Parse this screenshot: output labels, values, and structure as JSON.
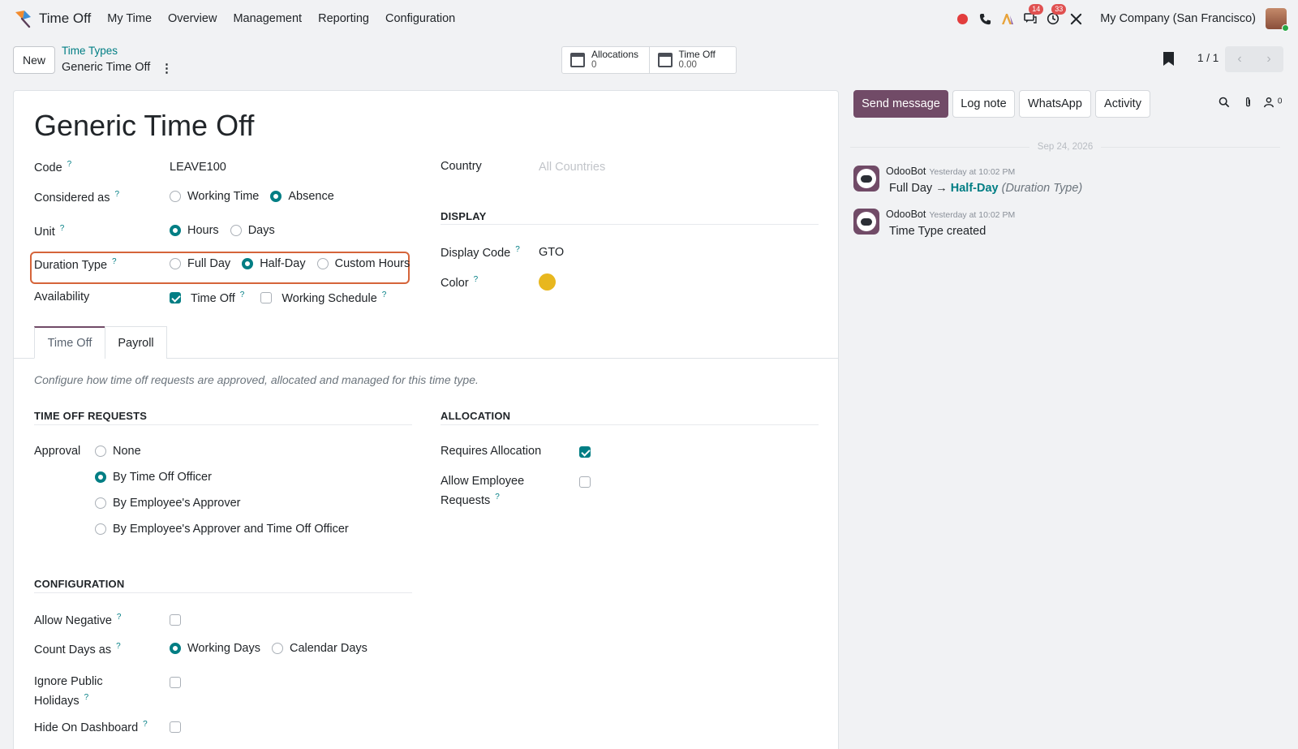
{
  "navbar": {
    "app_name": "Time Off",
    "menu": [
      "My Time",
      "Overview",
      "Management",
      "Reporting",
      "Configuration"
    ],
    "messages_badge": "14",
    "activities_badge": "33",
    "company": "My Company (San Francisco)"
  },
  "control": {
    "new_label": "New",
    "breadcrumb_parent": "Time Types",
    "breadcrumb_current": "Generic Time Off",
    "smart_buttons": [
      {
        "label": "Allocations",
        "value": "0"
      },
      {
        "label": "Time Off",
        "value": "0.00"
      }
    ],
    "pager": "1 / 1"
  },
  "form": {
    "title": "Generic Time Off",
    "code_label": "Code",
    "code_value": "LEAVE100",
    "considered_label": "Considered as",
    "considered_options": [
      "Working Time",
      "Absence"
    ],
    "considered_selected": "Absence",
    "unit_label": "Unit",
    "unit_options": [
      "Hours",
      "Days"
    ],
    "unit_selected": "Hours",
    "duration_label": "Duration Type",
    "duration_options": [
      "Full Day",
      "Half-Day",
      "Custom Hours"
    ],
    "duration_selected": "Half-Day",
    "availability_label": "Availability",
    "availability_timeoff": "Time Off",
    "availability_schedule": "Working Schedule",
    "country_label": "Country",
    "country_placeholder": "All Countries",
    "display_header": "DISPLAY",
    "display_code_label": "Display Code",
    "display_code_value": "GTO",
    "color_label": "Color",
    "color_value": "#e8b71e",
    "tabs": [
      "Time Off",
      "Payroll"
    ],
    "description": "Configure how time off requests are approved, allocated and managed for this time type.",
    "requests_header": "TIME OFF REQUESTS",
    "approval_label": "Approval",
    "approval_options": [
      "None",
      "By Time Off Officer",
      "By Employee's Approver",
      "By Employee's Approver and Time Off Officer"
    ],
    "approval_selected": "By Time Off Officer",
    "allocation_header": "ALLOCATION",
    "requires_allocation_label": "Requires Allocation",
    "allow_employee_requests_label_1": "Allow Employee",
    "allow_employee_requests_label_2": "Requests",
    "configuration_header": "CONFIGURATION",
    "allow_negative_label": "Allow Negative",
    "count_days_label": "Count Days as",
    "count_days_options": [
      "Working Days",
      "Calendar Days"
    ],
    "count_days_selected": "Working Days",
    "ignore_holidays_label_1": "Ignore Public",
    "ignore_holidays_label_2": "Holidays",
    "hide_dashboard_label": "Hide On Dashboard",
    "help_mark": "?"
  },
  "chatter": {
    "send_message": "Send message",
    "log_note": "Log note",
    "whatsapp": "WhatsApp",
    "activity": "Activity",
    "followers_count": "0",
    "date_separator": "Sep 24, 2026",
    "messages": [
      {
        "author": "OdooBot",
        "date": "Yesterday at 10:02 PM",
        "old_value": "Full Day",
        "arrow": "→",
        "new_value": "Half-Day",
        "field": "(Duration Type)"
      },
      {
        "author": "OdooBot",
        "date": "Yesterday at 10:02 PM",
        "body": "Time Type created"
      }
    ]
  }
}
